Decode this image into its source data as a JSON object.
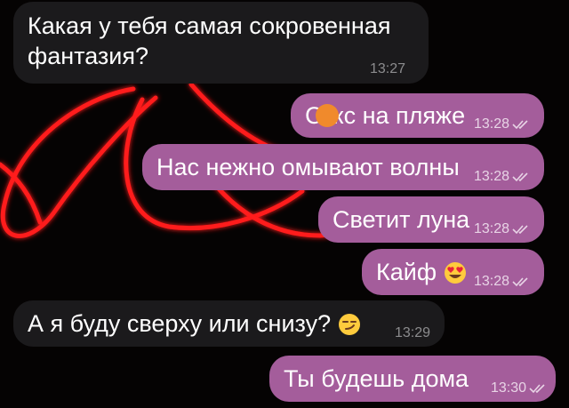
{
  "chat": {
    "messages": [
      {
        "direction": "incoming",
        "lines": [
          "Какая у тебя самая сокровенная",
          "фантазия?"
        ],
        "time": "13:27"
      },
      {
        "direction": "outgoing",
        "text_start": "С",
        "text_end": "кс на пляже",
        "obscured_by": "orange-circle",
        "time": "13:28",
        "status": "read"
      },
      {
        "direction": "outgoing",
        "text": "Нас нежно омывают волны",
        "time": "13:28",
        "status": "read"
      },
      {
        "direction": "outgoing",
        "text": "Светит луна",
        "time": "13:28",
        "status": "read"
      },
      {
        "direction": "outgoing",
        "text": "Кайф",
        "emoji": "heart-eyes-emoji",
        "time": "13:28",
        "status": "read"
      },
      {
        "direction": "incoming",
        "text": "А я буду сверху или снизу?",
        "emoji": "smirk-emoji",
        "time": "13:29"
      },
      {
        "direction": "outgoing",
        "text": "Ты будешь дома",
        "time": "13:30",
        "status": "read"
      }
    ]
  },
  "colors": {
    "background": "#050303",
    "incoming_bubble": "#1b1a1c",
    "outgoing_bubble": "#a45d9b",
    "neon": "#ff1a1a"
  }
}
